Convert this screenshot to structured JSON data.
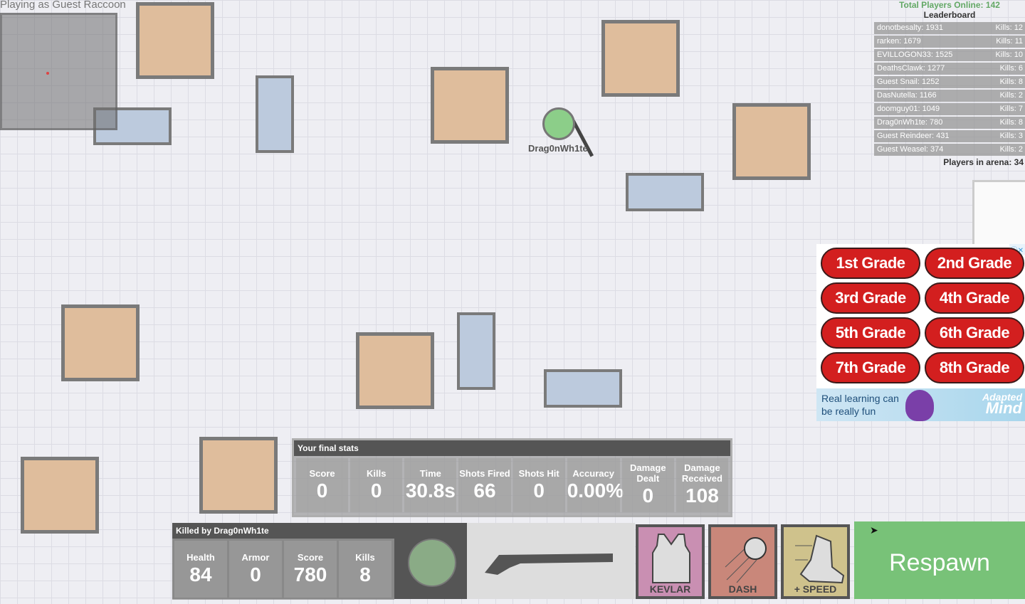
{
  "playing_as": "Playing as Guest Raccoon",
  "player": {
    "name": "Drag0nWh1te",
    "color": "#8cce89"
  },
  "leaderboard": {
    "total_online": "Total Players Online: 142",
    "title": "Leaderboard",
    "rows": [
      {
        "name": "donotbesalty: 1931",
        "kills": "Kills: 12"
      },
      {
        "name": "rarken: 1679",
        "kills": "Kills: 11"
      },
      {
        "name": "EVILLOGON33: 1525",
        "kills": "Kills: 10"
      },
      {
        "name": "DeathsClawk: 1277",
        "kills": "Kills: 6"
      },
      {
        "name": "Guest Snail: 1252",
        "kills": "Kills: 8"
      },
      {
        "name": "DasNutella: 1166",
        "kills": "Kills: 2"
      },
      {
        "name": "doomguy01: 1049",
        "kills": "Kills: 7"
      },
      {
        "name": "Drag0nWh1te: 780",
        "kills": "Kills: 8"
      },
      {
        "name": "Guest Reindeer: 431",
        "kills": "Kills: 3"
      },
      {
        "name": "Guest Weasel: 374",
        "kills": "Kills: 2"
      }
    ],
    "arena": "Players in arena: 34"
  },
  "ad": {
    "buttons": [
      "1st Grade",
      "2nd Grade",
      "3rd Grade",
      "4th Grade",
      "5th Grade",
      "6th Grade",
      "7th Grade",
      "8th Grade"
    ],
    "tagline": "Real learning can be really fun",
    "brand_top": "Adapted",
    "brand_bottom": "Mind"
  },
  "final_stats": {
    "title": "Your final stats",
    "cells": [
      {
        "label": "Score",
        "value": "0"
      },
      {
        "label": "Kills",
        "value": "0"
      },
      {
        "label": "Time",
        "value": "30.8s"
      },
      {
        "label": "Shots Fired",
        "value": "66"
      },
      {
        "label": "Shots Hit",
        "value": "0"
      },
      {
        "label": "Accuracy",
        "value": "0.00%"
      },
      {
        "label": "Damage Dealt",
        "value": "0"
      },
      {
        "label": "Damage Received",
        "value": "108"
      }
    ]
  },
  "killer": {
    "title": "Killed by Drag0nWh1te",
    "cells": [
      {
        "label": "Health",
        "value": "84"
      },
      {
        "label": "Armor",
        "value": "0"
      },
      {
        "label": "Score",
        "value": "780"
      },
      {
        "label": "Kills",
        "value": "8"
      }
    ]
  },
  "loadout": {
    "items": [
      {
        "name": "KEVLAR",
        "color": "#c98fb2"
      },
      {
        "name": "DASH",
        "color": "#c9877a"
      },
      {
        "name": "+ SPEED",
        "color": "#cfc28c"
      }
    ]
  },
  "respawn": "Respawn"
}
